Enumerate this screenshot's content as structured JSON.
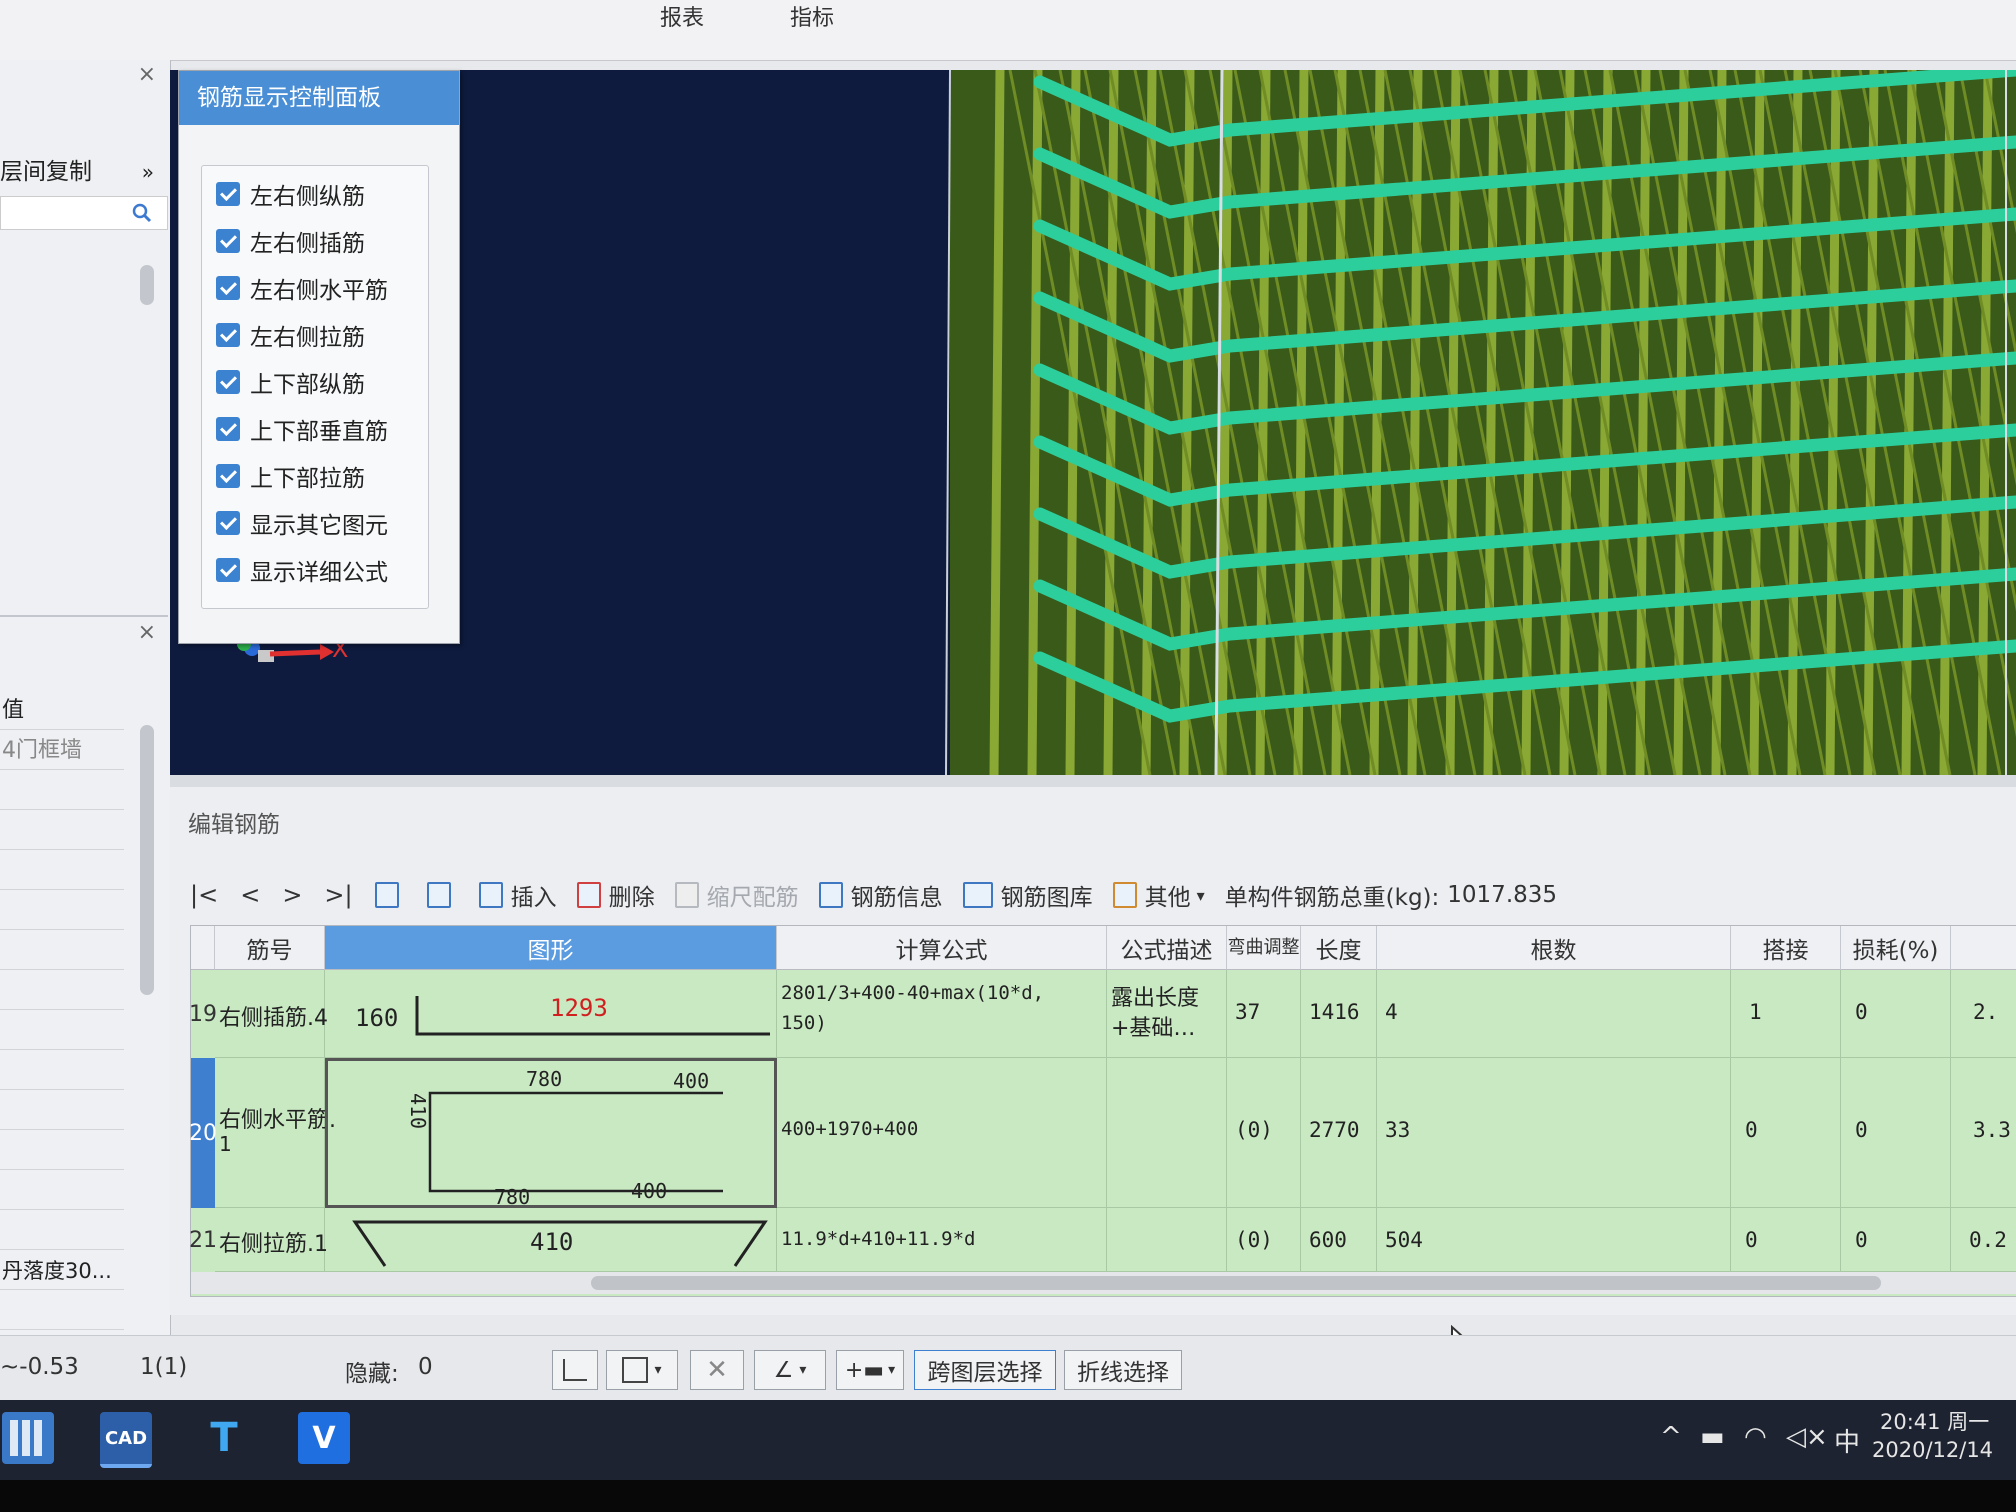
{
  "top_menu": [
    "报表",
    "指标"
  ],
  "left_panel": {
    "copy_item": "层间复制",
    "copy_arrow": "»",
    "rows": [
      "值",
      "4门框墙",
      "丹落度30..."
    ]
  },
  "control_panel": {
    "title": "钢筋显示控制面板",
    "options": [
      "左右侧纵筋",
      "左右侧插筋",
      "左右侧水平筋",
      "左右侧拉筋",
      "上下部纵筋",
      "上下部垂直筋",
      "上下部拉筋",
      "显示其它图元",
      "显示详细公式"
    ]
  },
  "axis": {
    "x_label": "X"
  },
  "edit_panel": {
    "title": "编辑钢筋",
    "nav": [
      "|<",
      "<",
      ">",
      ">|"
    ],
    "toolbar": {
      "insert": "插入",
      "delete": "删除",
      "scale_rebar": "缩尺配筋",
      "rebar_info": "钢筋信息",
      "rebar_library": "钢筋图库",
      "other": "其他",
      "other_arrow": "▾",
      "total_weight_label": "单构件钢筋总重(kg):",
      "total_weight_value": "1017.835"
    },
    "columns": {
      "bar_no": "筋号",
      "shape": "图形",
      "formula": "计算公式",
      "formula_desc": "公式描述",
      "bend_adjust": "弯曲调整",
      "length": "长度",
      "count": "根数",
      "lap": "搭接",
      "loss": "损耗(%)"
    },
    "rows": [
      {
        "num": "19",
        "name": "右侧插筋.4",
        "shape_left": "160",
        "shape_main": "1293",
        "formula_line1": "2801/3+400-40+max(10*d,",
        "formula_line2": "150)",
        "desc_line1": "露出长度",
        "desc_line2": "+基础…",
        "bend": "37",
        "length": "1416",
        "count": "4",
        "lap": "1",
        "loss": "0",
        "extra": "2."
      },
      {
        "num": "20",
        "name_line1": "右侧水平筋.",
        "name_line2": "1",
        "shape_vertical": "410",
        "shape_top_a": "780",
        "shape_top_b": "400",
        "shape_bot_a": "780",
        "shape_bot_b": "400",
        "formula": "400+1970+400",
        "bend": "(0)",
        "length": "2770",
        "count": "33",
        "lap": "0",
        "loss": "0",
        "extra": "3.3"
      },
      {
        "num": "21",
        "name": "右侧拉筋.1",
        "shape_main": "410",
        "formula": "11.9*d+410+11.9*d",
        "bend": "(0)",
        "length": "600",
        "count": "504",
        "lap": "0",
        "loss": "0",
        "extra": "0.2"
      }
    ]
  },
  "status_bar": {
    "elevation": "~-0.53",
    "layer": "1(1)",
    "hidden_label": "隐藏:",
    "hidden_value": "0",
    "cross_layer_select": "跨图层选择",
    "polyline_select": "折线选择"
  },
  "taskbar": {
    "time": "20:41 周一",
    "date": "2020/12/14",
    "ime": "中",
    "apps": [
      "calculator",
      "CAD",
      "T",
      "V"
    ]
  },
  "colors": {
    "viewport_bg": "#0e1b3e",
    "rebar_teal": "#28c99a",
    "rebar_olive": "#7e9a2e",
    "panel_title_blue": "#4a8fd6",
    "row_green": "#c9e9c3"
  }
}
